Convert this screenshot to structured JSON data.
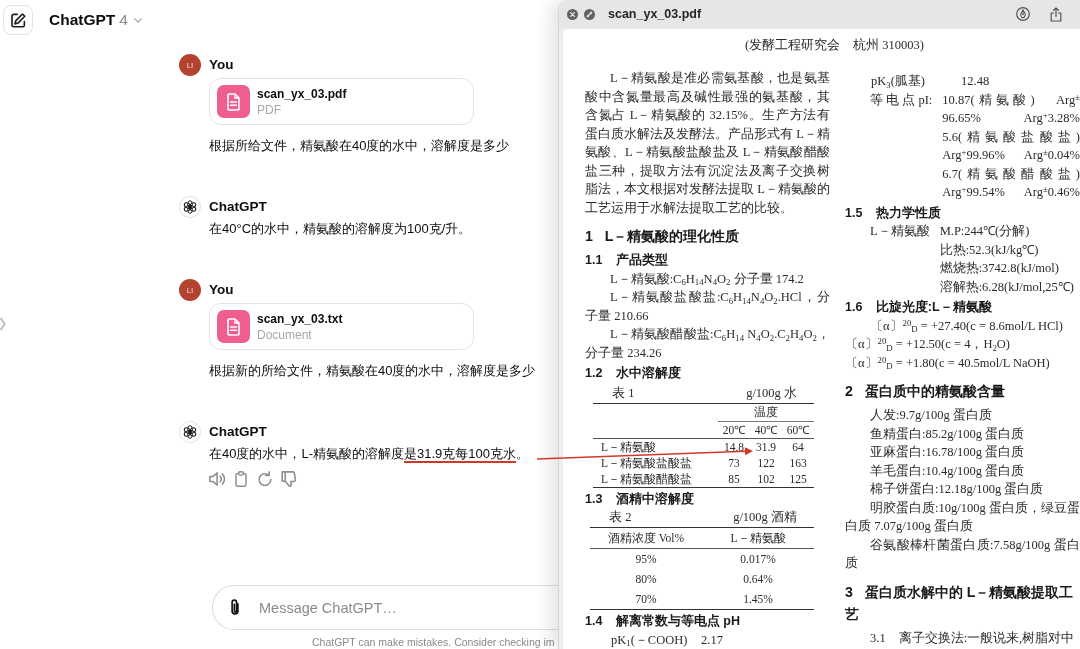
{
  "chat": {
    "header": {
      "title": "ChatGPT",
      "version": "4"
    },
    "messages": [
      {
        "kind": "user",
        "author": "You",
        "avatar": "LI",
        "attachment": {
          "name": "scan_yx_03.pdf",
          "type": "PDF"
        },
        "segments": [
          {
            "text": "根据所给文件，精氨酸在40度的水中，溶解度是多少",
            "underlined": false
          }
        ]
      },
      {
        "kind": "assistant",
        "author": "ChatGPT",
        "actions_visible": false,
        "segments": [
          {
            "text": "在40°C的水中，精氨酸的溶解度为100克/升。",
            "underlined": false
          }
        ]
      },
      {
        "kind": "user",
        "author": "You",
        "avatar": "LI",
        "attachment": {
          "name": "scan_yx_03.txt",
          "type": "Document"
        },
        "segments": [
          {
            "text": "根据新的所给文件，精氨酸在40度的水中，溶解度是多少",
            "underlined": false
          }
        ]
      },
      {
        "kind": "assistant",
        "author": "ChatGPT",
        "actions_visible": true,
        "segments": [
          {
            "text": "在40度的水中，L-精氨酸的溶解度",
            "underlined": false
          },
          {
            "text": "是31.9克每100克水",
            "underlined": true
          },
          {
            "text": "。",
            "underlined": false
          }
        ]
      }
    ],
    "composer": {
      "placeholder": "Message ChatGPT…"
    },
    "disclaimer": "ChatGPT can make mistakes. Consider checking im"
  },
  "viewer": {
    "title": "scan_yx_03.pdf",
    "document": {
      "affiliation": "(发酵工程研究会　杭州 310003)",
      "columns": [
        {
          "blocks": [
            {
              "kind": "para",
              "indent": true,
              "text": "L－精氨酸是准必需氨基酸，也是氨基酸中含氮量最高及碱性最强的氨基酸，其含氮占 L－精氨酸的 32.15%。生产方法有蛋白质水解法及发酵法。产品形式有 L－精氨酸、L－精氨酸盐酸盐及 L－精氨酸醋酸盐三种，提取方法有沉淀法及离子交换树脂法，本文根据对发酵法提取 L－精氨酸的工艺运用于水解法提取工艺的比较。"
            },
            {
              "kind": "h1",
              "number": "1",
              "text": "L－精氨酸的理化性质"
            },
            {
              "kind": "h2",
              "number": "1.1",
              "text": "产品类型"
            },
            {
              "kind": "para",
              "indent": true,
              "text": "L－精氨酸:C$_{6}$H$_{14}$N$_{4}$O$_{2}$ 分子量 174.2"
            },
            {
              "kind": "para",
              "indent": true,
              "text": "L－精氨酸盐酸盐:C$_{6}$H$_{14}$N$_{4}$O$_{2}$.HCl，分子量 210.66"
            },
            {
              "kind": "para",
              "indent": true,
              "text": "L－精氨酸醋酸盐:C$_{6}$H$_{14}$ N$_{4}$O$_{2}$.C$_{2}$H$_{4}$O$_{2}$，分子量 234.26"
            },
            {
              "kind": "h2",
              "number": "1.2",
              "text": "水中溶解度"
            },
            {
              "kind": "table",
              "caption": "表 1",
              "unit": "g/100g 水",
              "group_header": "温度",
              "columns": [
                "20℃",
                "40℃",
                "60℃"
              ],
              "rows": [
                {
                  "label": "L－精氨酸",
                  "values": [
                    "14.8",
                    "31.9",
                    "64"
                  ]
                },
                {
                  "label": "L－精氨酸盐酸盐",
                  "values": [
                    "73",
                    "122",
                    "163"
                  ]
                },
                {
                  "label": "L－精氨酸醋酸盐",
                  "values": [
                    "85",
                    "102",
                    "125"
                  ]
                }
              ]
            },
            {
              "kind": "h2",
              "number": "1.3",
              "text": "酒精中溶解度"
            },
            {
              "kind": "table",
              "caption": "表 2",
              "unit": "g/100g 酒精",
              "label_header": "酒精浓度 Vol%",
              "columns": [
                "L－精氨酸"
              ],
              "rows": [
                {
                  "label": "95%",
                  "values": [
                    "0.017%"
                  ]
                },
                {
                  "label": "80%",
                  "values": [
                    "0.64%"
                  ]
                },
                {
                  "label": "70%",
                  "values": [
                    "1.45%"
                  ]
                }
              ]
            },
            {
              "kind": "h2",
              "number": "1.4",
              "text": "解离常数与等电点 pH"
            },
            {
              "kind": "pair",
              "label": "pK$_{1}$(－COOH)",
              "value": "2.17"
            }
          ]
        },
        {
          "blocks": [
            {
              "kind": "pair",
              "label": "pK$_{3}$(胍基)",
              "value": "12.48"
            },
            {
              "kind": "hang",
              "label": "等 电 点 pI:",
              "justified": true,
              "lines": [
                "10.87(精氨酸)　Arg$^{±}$",
                "96.65%　Arg$^{+}$3.28%",
                "5.6(精氨酸盐酸盐)",
                "Arg$^{+}$99.96%　Arg$^{±}$0.04%",
                "6.7(精氨酸醋酸盐)",
                "Arg$^{+}$99.54%　Arg$^{±}$0.46%"
              ]
            },
            {
              "kind": "h2",
              "number": "1.5",
              "text": "热力学性质"
            },
            {
              "kind": "hang",
              "label": "L－精氨酸",
              "justified": false,
              "lines": [
                "M.P:244℃(分解)",
                "比热:52.3(kJ/kg℃)",
                "燃烧热:3742.8(kJ/mol)",
                "溶解热:6.28(kJ/mol,25℃)"
              ]
            },
            {
              "kind": "h2",
              "number": "1.6",
              "text": "比旋光度:L－精氨酸"
            },
            {
              "kind": "para",
              "indent": true,
              "text": "〔α〕$^{20}$$_{D}$ = +27.40(c = 8.6mol/L HCl)"
            },
            {
              "kind": "para",
              "indent": false,
              "text": "〔α〕$^{20}$$_{D}$ = +12.50(c = 4，H$_{2}$O)"
            },
            {
              "kind": "para",
              "indent": false,
              "text": "〔α〕$^{20}$$_{D}$ = +1.80(c = 40.5mol/L NaOH)"
            },
            {
              "kind": "h1",
              "number": "2",
              "text": "蛋白质中的精氨酸含量"
            },
            {
              "kind": "para",
              "indent": true,
              "text": "人发:9.7g/100g 蛋白质"
            },
            {
              "kind": "para",
              "indent": true,
              "text": "鱼精蛋白:85.2g/100g 蛋白质"
            },
            {
              "kind": "para",
              "indent": true,
              "text": "亚麻蛋白:16.78/100g 蛋白质"
            },
            {
              "kind": "para",
              "indent": true,
              "text": "羊毛蛋白:10.4g/100g 蛋白质"
            },
            {
              "kind": "para",
              "indent": true,
              "text": "棉子饼蛋白:12.18g/100g 蛋白质"
            },
            {
              "kind": "para",
              "indent": true,
              "text": "明胶蛋白质:10g/100g 蛋白质，绿豆蛋白质 7.07g/100g 蛋白质"
            },
            {
              "kind": "para",
              "indent": true,
              "text": "谷氨酸棒杆菌蛋白质:7.58g/100g 蛋白质"
            },
            {
              "kind": "h1",
              "number": "3",
              "text": "蛋白质水解中的 L－精氨酸提取工艺"
            },
            {
              "kind": "para",
              "indent": true,
              "text": "3.1　离子交换法:一般说来,树脂对中"
            }
          ]
        }
      ]
    }
  }
}
